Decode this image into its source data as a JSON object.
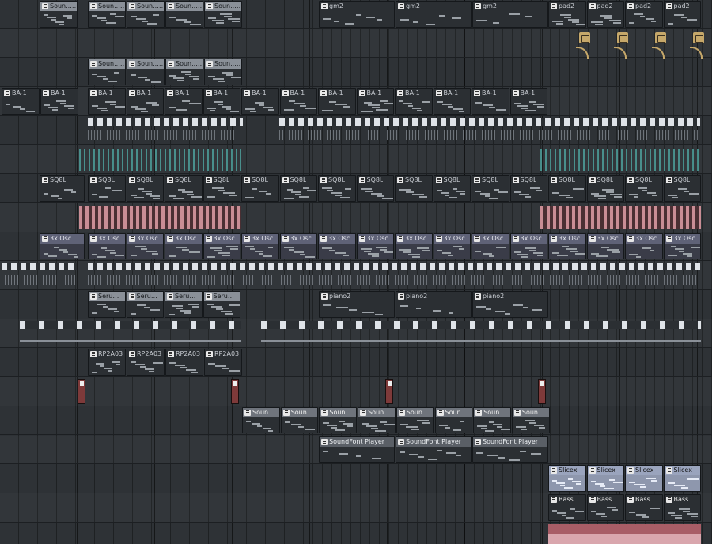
{
  "app": {
    "view": "Playlist"
  },
  "tracks": [
    {
      "id": 1,
      "clips": [
        {
          "label": "Soun...yer"
        },
        {
          "label": "Soun...yer"
        },
        {
          "label": "Soun...yer"
        },
        {
          "label": "Soun...yer"
        },
        {
          "label": "Soun...yer"
        },
        {
          "label": "gm2"
        },
        {
          "label": "gm2"
        },
        {
          "label": "gm2"
        },
        {
          "label": "pad2"
        },
        {
          "label": "pad2"
        },
        {
          "label": "pad2"
        },
        {
          "label": "pad2"
        }
      ]
    },
    {
      "id": 2,
      "clips": [],
      "automation_icons": [
        "automation-clip-icon",
        "automation-clip-icon",
        "automation-clip-icon",
        "automation-clip-icon"
      ]
    },
    {
      "id": 3,
      "clips": [
        {
          "label": "Soun...r #2"
        },
        {
          "label": "Soun...r #2"
        },
        {
          "label": "Soun...r #2"
        },
        {
          "label": "Soun...r #2"
        }
      ]
    },
    {
      "id": 4,
      "clips": [
        {
          "label": "BA-1"
        },
        {
          "label": "BA-1"
        },
        {
          "label": "BA-1"
        },
        {
          "label": "BA-1"
        },
        {
          "label": "BA-1"
        },
        {
          "label": "BA-1"
        },
        {
          "label": "BA-1"
        },
        {
          "label": "BA-1"
        },
        {
          "label": "BA-1"
        },
        {
          "label": "BA-1"
        },
        {
          "label": "BA-1"
        },
        {
          "label": "BA-1"
        },
        {
          "label": "BA-1"
        },
        {
          "label": "BA-1"
        }
      ]
    },
    {
      "id": 5,
      "clips": []
    },
    {
      "id": 6,
      "clips": []
    },
    {
      "id": 7,
      "clips": [
        {
          "label": "SQ8L"
        },
        {
          "label": "SQ8L"
        },
        {
          "label": "SQ8L"
        },
        {
          "label": "SQ8L"
        },
        {
          "label": "SQ8L"
        },
        {
          "label": "SQ8L"
        },
        {
          "label": "SQ8L"
        },
        {
          "label": "SQ8L"
        },
        {
          "label": "SQ8L"
        },
        {
          "label": "SQ8L"
        },
        {
          "label": "SQ8L"
        },
        {
          "label": "SQ8L"
        },
        {
          "label": "SQ8L"
        },
        {
          "label": "SQ8L"
        },
        {
          "label": "SQ8L"
        },
        {
          "label": "SQ8L"
        },
        {
          "label": "SQ8L"
        }
      ]
    },
    {
      "id": 8,
      "clips": []
    },
    {
      "id": 9,
      "clips": [
        {
          "label": "3x Osc"
        },
        {
          "label": "3x Osc"
        },
        {
          "label": "3x Osc"
        },
        {
          "label": "3x Osc"
        },
        {
          "label": "3x Osc"
        },
        {
          "label": "3x Osc"
        },
        {
          "label": "3x Osc"
        },
        {
          "label": "3x Osc"
        },
        {
          "label": "3x Osc"
        },
        {
          "label": "3x Osc"
        },
        {
          "label": "3x Osc"
        },
        {
          "label": "3x Osc"
        },
        {
          "label": "3x Osc"
        },
        {
          "label": "3x Osc"
        },
        {
          "label": "3x Osc"
        },
        {
          "label": "3x Osc"
        },
        {
          "label": "3x Osc"
        }
      ]
    },
    {
      "id": 10,
      "clips": []
    },
    {
      "id": 11,
      "clips": [
        {
          "label": "Serum 2"
        },
        {
          "label": "Serum 2"
        },
        {
          "label": "Serum 2"
        },
        {
          "label": "Serum 2"
        },
        {
          "label": "piano2"
        },
        {
          "label": "piano2"
        },
        {
          "label": "piano2"
        }
      ]
    },
    {
      "id": 12,
      "clips": []
    },
    {
      "id": 13,
      "clips": [
        {
          "label": "RP2A03"
        },
        {
          "label": "RP2A03"
        },
        {
          "label": "RP2A03"
        },
        {
          "label": "RP2A03"
        }
      ]
    },
    {
      "id": 14,
      "clips": []
    },
    {
      "id": 15,
      "clips": [
        {
          "label": "Soun...yer"
        },
        {
          "label": "Soun...yer"
        },
        {
          "label": "Soun...yer"
        },
        {
          "label": "Soun...yer"
        },
        {
          "label": "Soun...yer"
        },
        {
          "label": "Soun...yer"
        },
        {
          "label": "Soun...yer"
        },
        {
          "label": "Soun...yer"
        }
      ]
    },
    {
      "id": 16,
      "clips": [
        {
          "label": "SoundFont Player"
        },
        {
          "label": "SoundFont Player"
        },
        {
          "label": "SoundFont Player"
        }
      ]
    },
    {
      "id": 17,
      "clips": [
        {
          "label": "Slicex"
        },
        {
          "label": "Slicex"
        },
        {
          "label": "Slicex"
        },
        {
          "label": "Slicex"
        }
      ]
    },
    {
      "id": 18,
      "clips": [
        {
          "label": "Bass...sion"
        },
        {
          "label": "Bass...sion"
        },
        {
          "label": "Bass...sion"
        },
        {
          "label": "Bass...sion"
        }
      ]
    },
    {
      "id": 19,
      "clips": []
    }
  ],
  "colors": {
    "background": "#2e3236",
    "pattern_grey": "#7b8087",
    "pattern_dark": "#23272b",
    "osc_purple": "#6c6f86",
    "sq8l_pink": "#c98d95",
    "teal": "#4fa5a0",
    "automation": "#c6a86a",
    "audio_red": "#7e3a3a",
    "slicex_blue": "#b9c2d6"
  }
}
